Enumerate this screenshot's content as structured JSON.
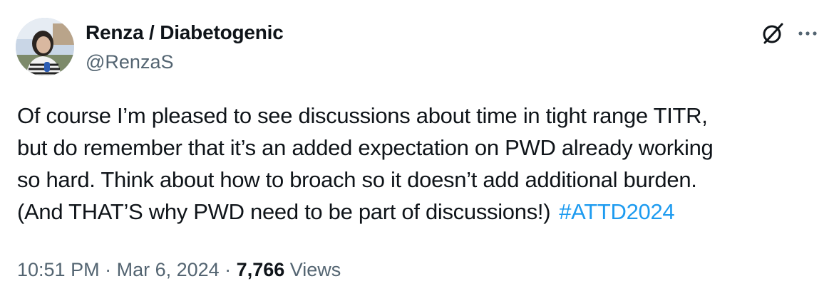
{
  "author": {
    "display_name": "Renza / Diabetogenic",
    "handle": "@RenzaS"
  },
  "icons": {
    "avatar": "profile-photo",
    "grok": "grok-icon",
    "more": "more-options-icon"
  },
  "tweet": {
    "lines": [
      "Of course I’m pleased to see discussions about time in tight range TITR,",
      "but do remember that it’s an added expectation on PWD already working",
      "so hard. Think about how to broach so it doesn’t add additional burden.",
      "(And THAT’S why PWD need to be part of discussions!)"
    ],
    "hashtag": "#ATTD2024"
  },
  "meta": {
    "time": "10:51 PM",
    "date": "Mar 6, 2024",
    "separator": " · ",
    "views_count": "7,766",
    "views_label": "Views"
  },
  "colors": {
    "text": "#0f1419",
    "secondary": "#536471",
    "link": "#1d9bf0",
    "background": "#ffffff"
  }
}
